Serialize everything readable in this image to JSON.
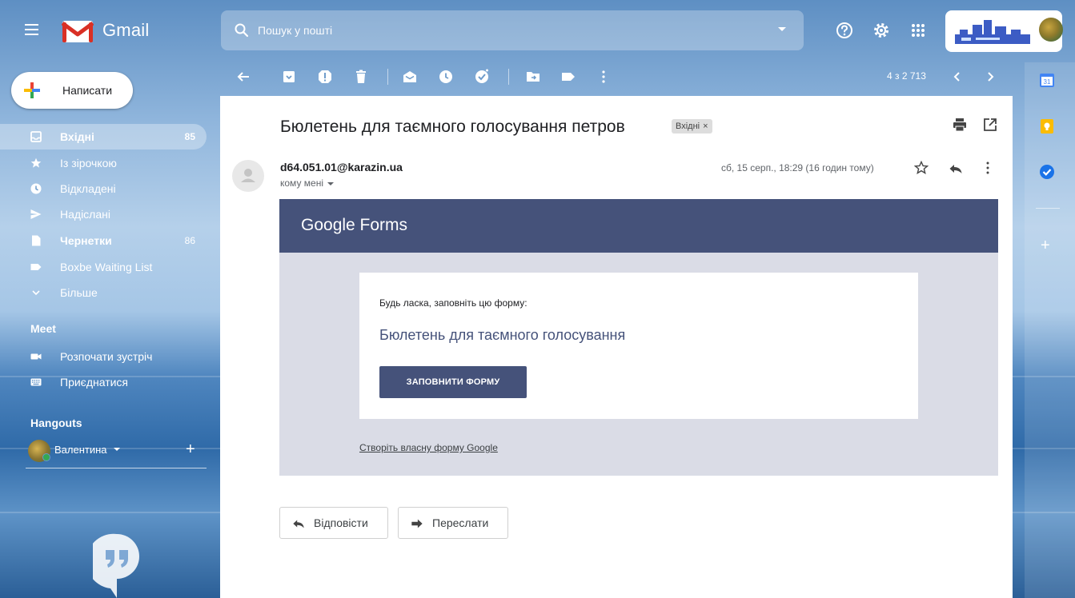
{
  "header": {
    "app_name": "Gmail",
    "search_placeholder": "Пошук у пошті"
  },
  "compose": {
    "label": "Написати"
  },
  "nav": {
    "items": [
      {
        "label": "Вхідні",
        "count": "85",
        "icon": "inbox-icon",
        "active": true,
        "bold": true
      },
      {
        "label": "Із зірочкою",
        "count": "",
        "icon": "star-icon"
      },
      {
        "label": "Відкладені",
        "count": "",
        "icon": "clock-icon"
      },
      {
        "label": "Надіслані",
        "count": "",
        "icon": "send-icon"
      },
      {
        "label": "Чернетки",
        "count": "86",
        "icon": "draft-icon",
        "bold": true
      },
      {
        "label": "Boxbe Waiting List",
        "count": "",
        "icon": "label-icon"
      },
      {
        "label": "Більше",
        "count": "",
        "icon": "chevron-down-icon"
      }
    ]
  },
  "meet": {
    "title": "Meet",
    "start_label": "Розпочати зустріч",
    "join_label": "Приєднатися"
  },
  "hangouts": {
    "title": "Hangouts",
    "user_name": "Валентина"
  },
  "toolbar": {
    "pager": "4 з 2 713"
  },
  "message": {
    "subject": "Бюлетень для таємного голосування петров",
    "label_chip": "Вхідні",
    "label_chip_close": "×",
    "sender": "d64.051.01@karazin.ua",
    "to": "кому мені",
    "date": "сб, 15 серп., 18:29 (16 годин тому)"
  },
  "forms": {
    "logo_bold": "Google",
    "logo_light": " Forms",
    "intro": "Будь ласка, заповніть цю форму:",
    "title": "Бюлетень для таємного голосування",
    "fill_button": "ЗАПОВНИТИ ФОРМУ",
    "create_link": "Створіть власну форму Google",
    "colors": {
      "banner": "#45527a",
      "background": "#dadce6"
    }
  },
  "actions": {
    "reply": "Відповісти",
    "forward": "Переслати"
  }
}
